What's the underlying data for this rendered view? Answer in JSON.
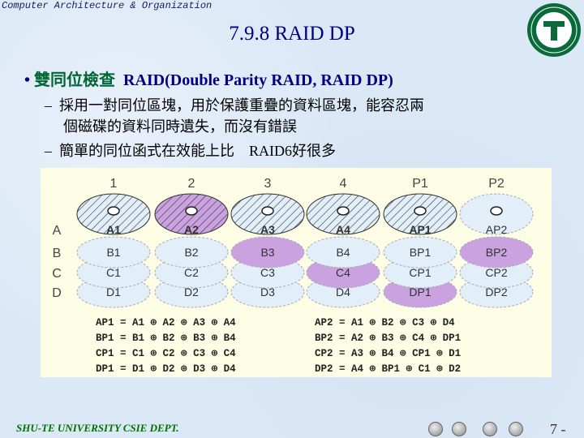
{
  "header": {
    "course": "Computer Architecture & Organization",
    "title": "7.9.8 RAID DP",
    "logo_text": "SHU-TE UNIVERSITY"
  },
  "bullets": [
    {
      "zh": "雙同位檢查",
      "en": "RAID(Double Parity RAID, RAID DP)"
    }
  ],
  "subbullets": [
    {
      "dash": "–",
      "text": "採用一對同位區塊，用於保護重疊的資料區塊，能容忍兩",
      "text2": "個磁碟的資料同時遺失，而沒有錯誤"
    },
    {
      "dash": "–",
      "text": "簡單的同位函式在效能上比　RAID6好很多"
    }
  ],
  "figure": {
    "columns": [
      "1",
      "2",
      "3",
      "4",
      "P1",
      "P2"
    ],
    "rows": [
      "A",
      "B",
      "C",
      "D"
    ],
    "cells": [
      [
        {
          "t": "A1",
          "s": "hatch"
        },
        {
          "t": "A2",
          "s": "hatch-purple"
        },
        {
          "t": "A3",
          "s": "hatch"
        },
        {
          "t": "A4",
          "s": "hatch"
        },
        {
          "t": "AP1",
          "s": "hatch"
        },
        {
          "t": "AP2",
          "s": "plain"
        }
      ],
      [
        {
          "t": "B1",
          "s": "plain"
        },
        {
          "t": "B2",
          "s": "plain"
        },
        {
          "t": "B3",
          "s": "purple"
        },
        {
          "t": "B4",
          "s": "plain"
        },
        {
          "t": "BP1",
          "s": "plain"
        },
        {
          "t": "BP2",
          "s": "purple"
        }
      ],
      [
        {
          "t": "C1",
          "s": "plain"
        },
        {
          "t": "C2",
          "s": "plain"
        },
        {
          "t": "C3",
          "s": "plain"
        },
        {
          "t": "C4",
          "s": "purple"
        },
        {
          "t": "CP1",
          "s": "plain"
        },
        {
          "t": "CP2",
          "s": "plain"
        }
      ],
      [
        {
          "t": "D1",
          "s": "plain"
        },
        {
          "t": "D2",
          "s": "plain"
        },
        {
          "t": "D3",
          "s": "plain"
        },
        {
          "t": "D4",
          "s": "plain"
        },
        {
          "t": "DP1",
          "s": "purple"
        },
        {
          "t": "DP2",
          "s": "plain"
        }
      ]
    ],
    "colors": {
      "plain": "#e2eff9",
      "purple": "#c9a2df",
      "panel": "#fdfde6"
    },
    "equations_left": [
      "AP1 = A1 ⊕ A2 ⊕ A3 ⊕ A4",
      "BP1 = B1 ⊕ B2 ⊕ B3 ⊕ B4",
      "CP1 = C1 ⊕ C2 ⊕ C3 ⊕ C4",
      "DP1 = D1 ⊕ D2 ⊕ D3 ⊕ D4"
    ],
    "equations_right": [
      "AP2 = A1 ⊕ B2 ⊕ C3 ⊕ D4",
      "BP2 = A2 ⊕ B3 ⊕ C4 ⊕ DP1",
      "CP2 = A3 ⊕ B4 ⊕ CP1 ⊕ D1",
      "DP2 = A4 ⊕ BP1 ⊕ C1 ⊕ D2"
    ]
  },
  "footer": {
    "dept": "SHU-TE UNIVERSITY  CSIE DEPT.",
    "page": "7 -",
    "nav": [
      "first-icon",
      "stop-icon",
      "prev-icon",
      "next-icon"
    ]
  }
}
